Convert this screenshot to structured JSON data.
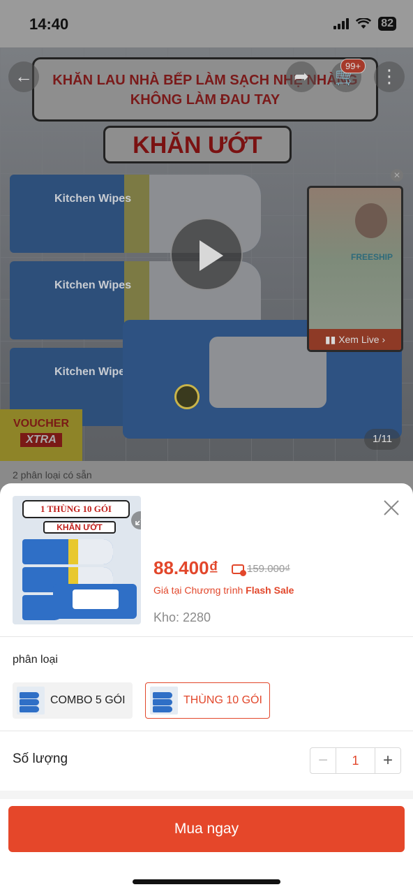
{
  "status_bar": {
    "time": "14:40",
    "battery": "82"
  },
  "product_image": {
    "banner_line1": "KHĂN LAU NHÀ BẾP LÀM SẠCH NHẸ NHÀNG",
    "banner_line2": "KHÔNG LÀM ĐAU TAY",
    "banner_main": "KHĂN ƯỚT",
    "pack_label": "Kitchen Wipes",
    "image_counter": "1/11",
    "voucher_line1": "VOUCHER",
    "voucher_line2": "XTRA"
  },
  "header": {
    "cart_badge": "99+"
  },
  "live_card": {
    "label": "Xem Live",
    "freeship": "FREESHIP"
  },
  "variants_note": "2 phân loại có sẵn",
  "sheet": {
    "thumbnail": {
      "line1": "1 THÙNG 10 GÓI",
      "line2": "KHĂN ƯỚT"
    },
    "price": "88.400₫",
    "original_price": "159.000₫",
    "flash_note_prefix": "Giá tại Chương trình ",
    "flash_note_highlight": "Flash Sale",
    "stock_label": "Kho: 2280",
    "option_section_label": "phân loại",
    "options": [
      {
        "label": "COMBO 5 GÓI",
        "selected": false
      },
      {
        "label": "THÙNG 10 GÓI",
        "selected": true
      }
    ],
    "quantity_label": "Số lượng",
    "quantity_value": "1",
    "decrement": "−",
    "increment": "+",
    "buy_button": "Mua ngay"
  },
  "colors": {
    "accent": "#e5472a",
    "price": "#e2472b"
  }
}
